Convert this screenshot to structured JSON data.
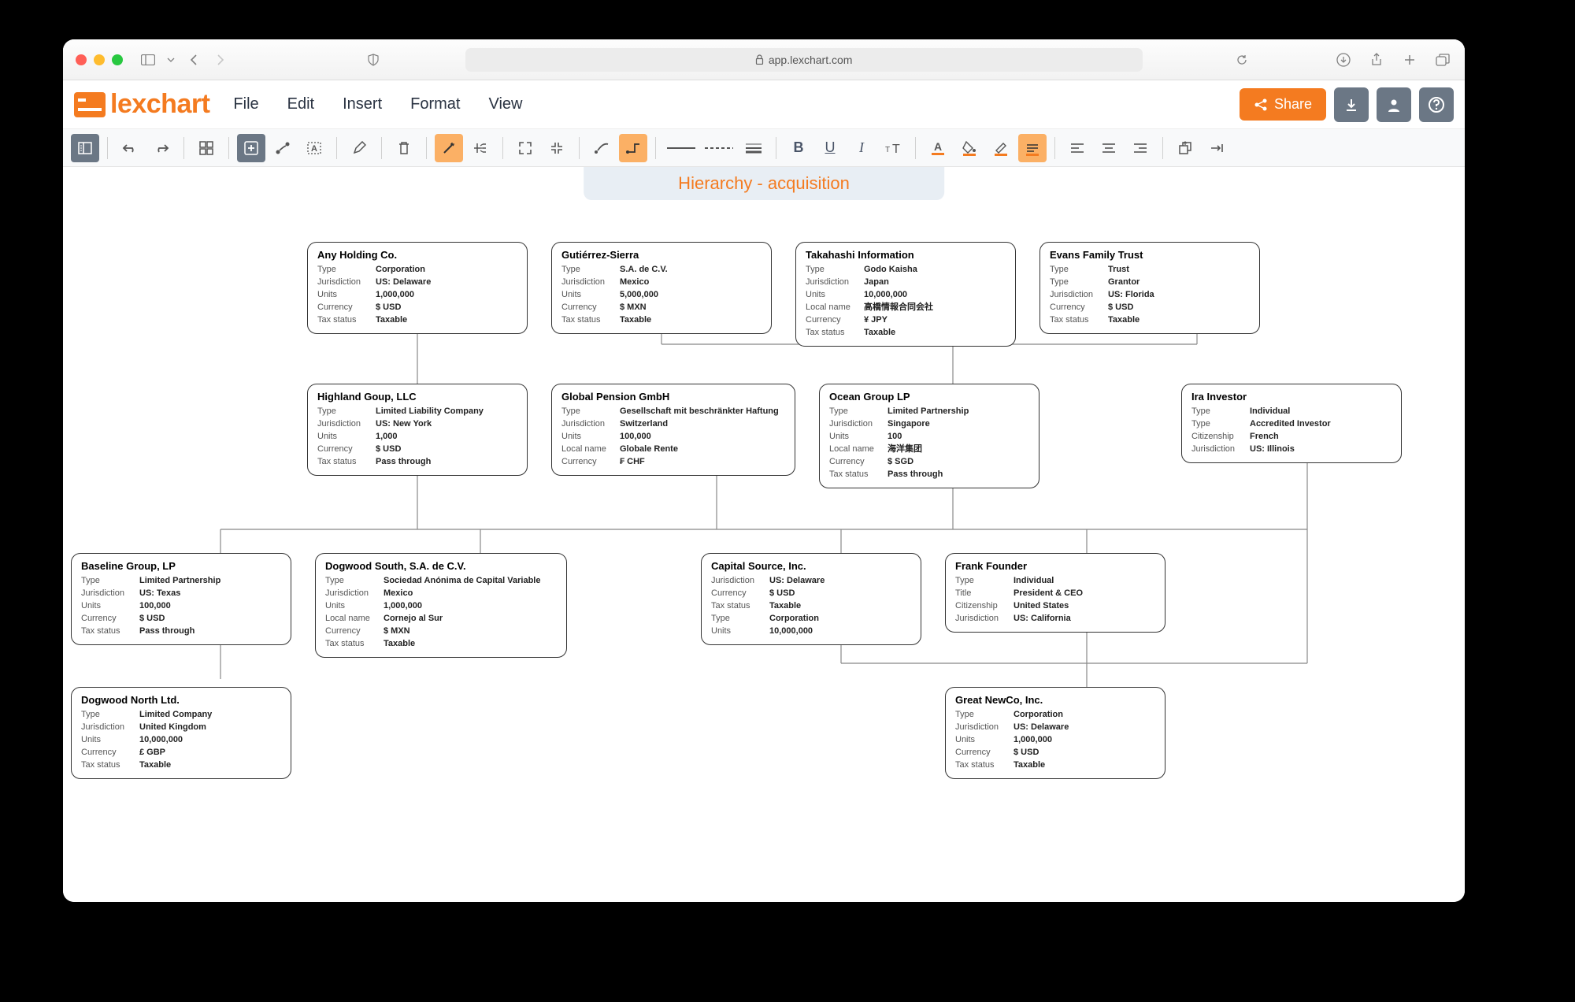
{
  "browser": {
    "url": "app.lexchart.com"
  },
  "app": {
    "logo_text": "lexchart",
    "menu": [
      "File",
      "Edit",
      "Insert",
      "Format",
      "View"
    ],
    "share_label": "Share"
  },
  "page_title": "Hierarchy - acquisition",
  "nodes": {
    "any_holding": {
      "title": "Any Holding Co.",
      "rows": [
        {
          "k": "Type",
          "v": "Corporation"
        },
        {
          "k": "Jurisdiction",
          "v": "US: Delaware"
        },
        {
          "k": "Units",
          "v": "1,000,000"
        },
        {
          "k": "Currency",
          "v": "$ USD"
        },
        {
          "k": "Tax status",
          "v": "Taxable"
        }
      ]
    },
    "gutierrez": {
      "title": "Gutiérrez-Sierra",
      "rows": [
        {
          "k": "Type",
          "v": "S.A. de C.V."
        },
        {
          "k": "Jurisdiction",
          "v": "Mexico"
        },
        {
          "k": "Units",
          "v": "5,000,000"
        },
        {
          "k": "Currency",
          "v": "$ MXN"
        },
        {
          "k": "Tax status",
          "v": "Taxable"
        }
      ]
    },
    "takahashi": {
      "title": "Takahashi Information",
      "rows": [
        {
          "k": "Type",
          "v": "Godo Kaisha"
        },
        {
          "k": "Jurisdiction",
          "v": "Japan"
        },
        {
          "k": "Units",
          "v": "10,000,000"
        },
        {
          "k": "Local name",
          "v": "高橋情報合同会社"
        },
        {
          "k": "Currency",
          "v": "¥ JPY"
        },
        {
          "k": "Tax status",
          "v": "Taxable"
        }
      ]
    },
    "evans": {
      "title": "Evans Family Trust",
      "rows": [
        {
          "k": "Type",
          "v": "Trust"
        },
        {
          "k": "Type",
          "v": "Grantor"
        },
        {
          "k": "Jurisdiction",
          "v": "US: Florida"
        },
        {
          "k": "Currency",
          "v": "$ USD"
        },
        {
          "k": "Tax status",
          "v": "Taxable"
        }
      ]
    },
    "highland": {
      "title": "Highland Goup, LLC",
      "rows": [
        {
          "k": "Type",
          "v": "Limited Liability Company"
        },
        {
          "k": "Jurisdiction",
          "v": "US: New York"
        },
        {
          "k": "Units",
          "v": "1,000"
        },
        {
          "k": "Currency",
          "v": "$ USD"
        },
        {
          "k": "Tax status",
          "v": "Pass through"
        }
      ]
    },
    "global_pension": {
      "title": "Global Pension GmbH",
      "rows": [
        {
          "k": "Type",
          "v": "Gesellschaft mit beschränkter Haftung"
        },
        {
          "k": "Jurisdiction",
          "v": "Switzerland"
        },
        {
          "k": "Units",
          "v": "100,000"
        },
        {
          "k": "Local name",
          "v": "Globale Rente"
        },
        {
          "k": "Currency",
          "v": "₣ CHF"
        }
      ]
    },
    "ocean_group": {
      "title": "Ocean Group LP",
      "rows": [
        {
          "k": "Type",
          "v": "Limited Partnership"
        },
        {
          "k": "Jurisdiction",
          "v": "Singapore"
        },
        {
          "k": "Units",
          "v": "100"
        },
        {
          "k": "Local name",
          "v": "海洋集团"
        },
        {
          "k": "Currency",
          "v": "$ SGD"
        },
        {
          "k": "Tax status",
          "v": "Pass through"
        }
      ]
    },
    "ira": {
      "title": "Ira Investor",
      "rows": [
        {
          "k": "Type",
          "v": "Individual"
        },
        {
          "k": "Type",
          "v": "Accredited Investor"
        },
        {
          "k": "Citizenship",
          "v": "French"
        },
        {
          "k": "Jurisdiction",
          "v": "US: Illinois"
        }
      ]
    },
    "baseline": {
      "title": "Baseline Group, LP",
      "rows": [
        {
          "k": "Type",
          "v": "Limited Partnership"
        },
        {
          "k": "Jurisdiction",
          "v": "US: Texas"
        },
        {
          "k": "Units",
          "v": "100,000"
        },
        {
          "k": "Currency",
          "v": "$ USD"
        },
        {
          "k": "Tax status",
          "v": "Pass through"
        }
      ]
    },
    "dogwood_south": {
      "title": "Dogwood South, S.A. de C.V.",
      "rows": [
        {
          "k": "Type",
          "v": "Sociedad Anónima de Capital Variable"
        },
        {
          "k": "Jurisdiction",
          "v": "Mexico"
        },
        {
          "k": "Units",
          "v": "1,000,000"
        },
        {
          "k": "Local name",
          "v": "Cornejo al Sur"
        },
        {
          "k": "Currency",
          "v": "$ MXN"
        },
        {
          "k": "Tax status",
          "v": "Taxable"
        }
      ]
    },
    "capital_source": {
      "title": "Capital Source, Inc.",
      "rows": [
        {
          "k": "Jurisdiction",
          "v": "US: Delaware"
        },
        {
          "k": "Currency",
          "v": "$ USD"
        },
        {
          "k": "Tax status",
          "v": "Taxable"
        },
        {
          "k": "Type",
          "v": "Corporation"
        },
        {
          "k": "Units",
          "v": "10,000,000"
        }
      ]
    },
    "frank": {
      "title": "Frank Founder",
      "rows": [
        {
          "k": "Type",
          "v": "Individual"
        },
        {
          "k": "Title",
          "v": "President & CEO"
        },
        {
          "k": "Citizenship",
          "v": "United States"
        },
        {
          "k": "Jurisdiction",
          "v": "US: California"
        }
      ]
    },
    "dogwood_north": {
      "title": "Dogwood North Ltd.",
      "rows": [
        {
          "k": "Type",
          "v": "Limited Company"
        },
        {
          "k": "Jurisdiction",
          "v": "United Kingdom"
        },
        {
          "k": "Units",
          "v": "10,000,000"
        },
        {
          "k": "Currency",
          "v": "£ GBP"
        },
        {
          "k": "Tax status",
          "v": "Taxable"
        }
      ]
    },
    "great_newco": {
      "title": "Great NewCo, Inc.",
      "rows": [
        {
          "k": "Type",
          "v": "Corporation"
        },
        {
          "k": "Jurisdiction",
          "v": "US: Delaware"
        },
        {
          "k": "Units",
          "v": "1,000,000"
        },
        {
          "k": "Currency",
          "v": "$ USD"
        },
        {
          "k": "Tax status",
          "v": "Taxable"
        }
      ]
    }
  }
}
